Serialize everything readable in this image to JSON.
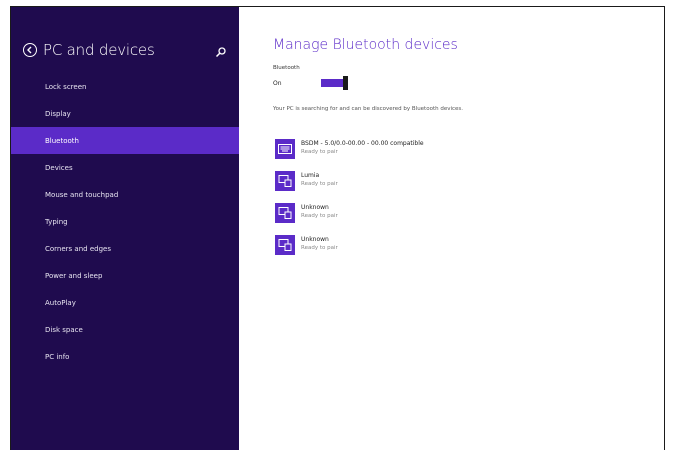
{
  "sidebar": {
    "title": "PC and devices",
    "items": [
      {
        "label": "Lock screen"
      },
      {
        "label": "Display"
      },
      {
        "label": "Bluetooth",
        "selected": true
      },
      {
        "label": "Devices"
      },
      {
        "label": "Mouse and touchpad"
      },
      {
        "label": "Typing"
      },
      {
        "label": "Corners and edges"
      },
      {
        "label": "Power and sleep"
      },
      {
        "label": "AutoPlay"
      },
      {
        "label": "Disk space"
      },
      {
        "label": "PC info"
      }
    ]
  },
  "main": {
    "title": "Manage Bluetooth devices",
    "bluetooth_label": "Bluetooth",
    "bluetooth_state": "On",
    "status_text": "Your PC is searching for and can be discovered by Bluetooth devices.",
    "devices": [
      {
        "name": "BSDM - 5.0/0.0-00.00 - 00.00 compatible",
        "status": "Ready to pair",
        "icon": "keyboard-icon"
      },
      {
        "name": "Lumia",
        "status": "Ready to pair",
        "icon": "device-icon"
      },
      {
        "name": "Unknown",
        "status": "Ready to pair",
        "icon": "device-icon"
      },
      {
        "name": "Unknown",
        "status": "Ready to pair",
        "icon": "device-icon"
      }
    ]
  },
  "colors": {
    "sidebar_bg": "#1f0b4e",
    "accent": "#5b2bc8"
  }
}
